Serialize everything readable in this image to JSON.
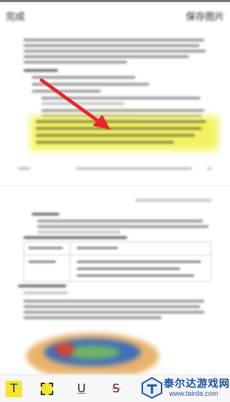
{
  "topbar": {
    "back_label": "完成",
    "done_label": "保存图片"
  },
  "toolbar": {
    "tools": [
      {
        "name": "text-tool",
        "icon": "T",
        "selected": true
      },
      {
        "name": "highlight-tool",
        "icon": "dashed-square",
        "selected": false
      },
      {
        "name": "underline-tool",
        "icon": "U",
        "selected": false
      },
      {
        "name": "strikethrough-tool",
        "icon": "S",
        "selected": false
      }
    ]
  },
  "watermark": {
    "title": "泰尔达游戏网",
    "url": "www.tairda.com"
  },
  "colors": {
    "highlight": "#f3f35a",
    "arrow": "#e8252b",
    "tool_selected_bg": "#f2e52e",
    "underline_accent": "#d8403a",
    "watermark_blue": "#1a4fa0"
  }
}
